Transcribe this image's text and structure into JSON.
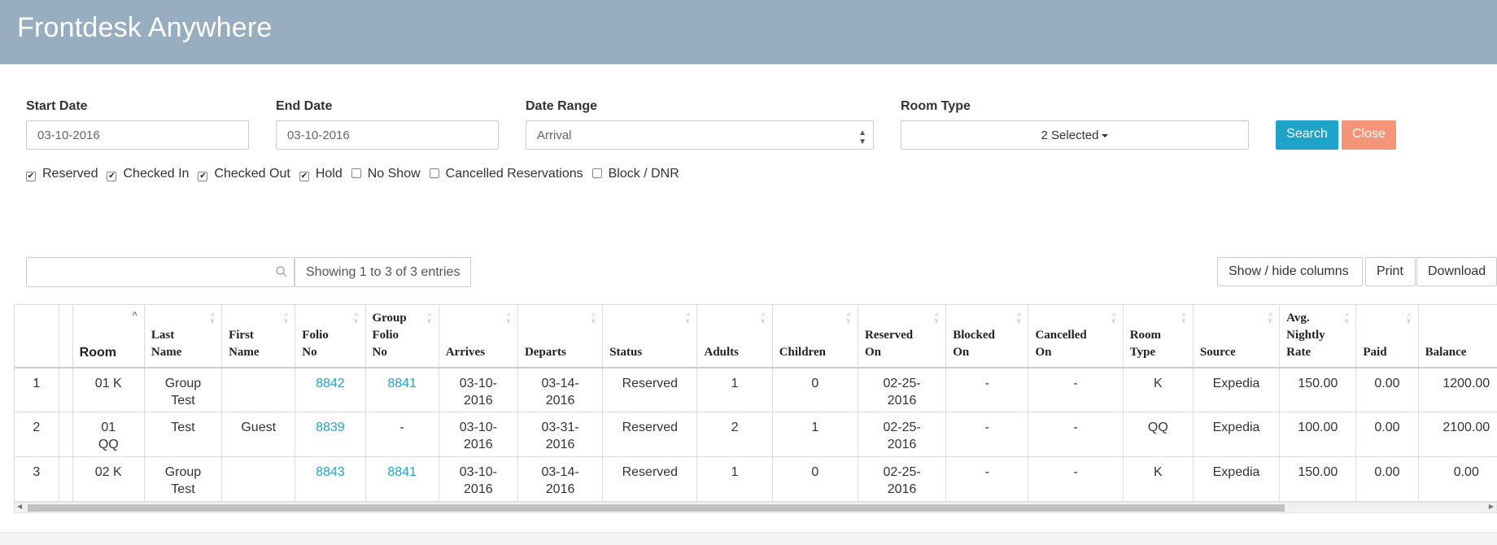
{
  "app": {
    "title": "Frontdesk Anywhere"
  },
  "filters": {
    "start_date": {
      "label": "Start Date",
      "value": "03-10-2016"
    },
    "end_date": {
      "label": "End Date",
      "value": "03-10-2016"
    },
    "date_range": {
      "label": "Date Range",
      "value": "Arrival"
    },
    "room_type": {
      "label": "Room Type",
      "value": "2 Selected"
    },
    "search_label": "Search",
    "close_label": "Close"
  },
  "checkboxes": [
    {
      "label": "Reserved",
      "checked": true
    },
    {
      "label": "Checked In",
      "checked": true
    },
    {
      "label": "Checked Out",
      "checked": true
    },
    {
      "label": "Hold",
      "checked": true
    },
    {
      "label": "No Show",
      "checked": false
    },
    {
      "label": "Cancelled Reservations",
      "checked": false
    },
    {
      "label": "Block / DNR",
      "checked": false
    }
  ],
  "table_tools": {
    "search_value": "",
    "entries_info": "Showing 1 to 3 of 3 entries",
    "show_hide_label": "Show / hide columns",
    "print_label": "Print",
    "download_label": "Download"
  },
  "table": {
    "headers": [
      "",
      "",
      "Room",
      "Last\nName",
      "First\nName",
      "Folio\nNo",
      "Group\nFolio\nNo",
      "Arrives",
      "Departs",
      "Status",
      "Adults",
      "Children",
      "Reserved\nOn",
      "Blocked\nOn",
      "Cancelled\nOn",
      "Room\nType",
      "Source",
      "Avg.\nNightly\nRate",
      "Paid",
      "Balance"
    ],
    "rows": [
      [
        "1",
        "",
        "01 K",
        "Group\nTest",
        "",
        "8842",
        "8841",
        "03-10-\n2016",
        "03-14-\n2016",
        "Reserved",
        "1",
        "0",
        "02-25-\n2016",
        "-",
        "-",
        "K",
        "Expedia",
        "150.00",
        "0.00",
        "1200.00"
      ],
      [
        "2",
        "",
        "01\nQQ",
        "Test",
        "Guest",
        "8839",
        "-",
        "03-10-\n2016",
        "03-31-\n2016",
        "Reserved",
        "2",
        "1",
        "02-25-\n2016",
        "-",
        "-",
        "QQ",
        "Expedia",
        "100.00",
        "0.00",
        "2100.00"
      ],
      [
        "3",
        "",
        "02 K",
        "Group\nTest",
        "",
        "8843",
        "8841",
        "03-10-\n2016",
        "03-14-\n2016",
        "Reserved",
        "1",
        "0",
        "02-25-\n2016",
        "-",
        "-",
        "K",
        "Expedia",
        "150.00",
        "0.00",
        "0.00"
      ]
    ]
  }
}
